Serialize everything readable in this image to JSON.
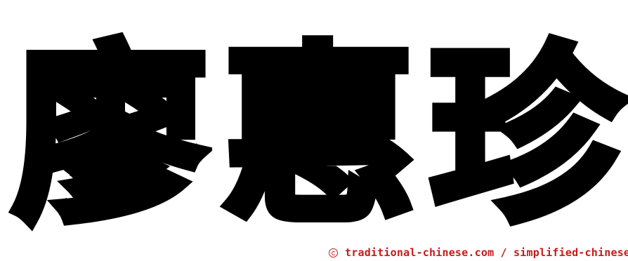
{
  "name": {
    "characters": [
      "廖",
      "惠",
      "珍"
    ]
  },
  "footer": {
    "icon": "copyright-icon",
    "text": "traditional-chinese.com / simplified-chinese",
    "color": "#c51b1b"
  },
  "colors": {
    "glyph": "#000000",
    "background": "#ffffff"
  }
}
